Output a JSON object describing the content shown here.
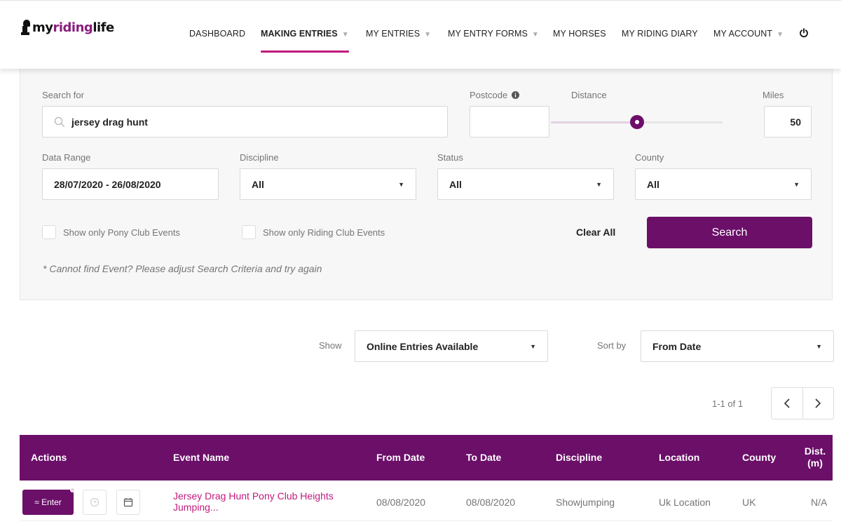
{
  "app": {
    "logo_prefix": "my",
    "logo_accent": "riding",
    "logo_suffix": "life"
  },
  "nav": {
    "dashboard": "DASHBOARD",
    "making_entries": "MAKING ENTRIES",
    "my_entries": "MY ENTRIES",
    "my_entry_forms": "MY ENTRY FORMS",
    "my_horses": "MY HORSES",
    "my_riding_diary": "MY RIDING DIARY",
    "my_account": "MY ACCOUNT",
    "active": "MAKING ENTRIES"
  },
  "search": {
    "search_for_label": "Search for",
    "search_value": "jersey drag hunt",
    "postcode_label": "Postcode",
    "postcode_value": "",
    "distance_label": "Distance",
    "distance_fraction": 0.5,
    "miles_label": "Miles",
    "miles_value": "50",
    "date_range_label": "Data Range",
    "date_range_value": "28/07/2020 - 26/08/2020",
    "discipline_label": "Discipline",
    "discipline_value": "All",
    "status_label": "Status",
    "status_value": "All",
    "county_label": "County",
    "county_value": "All",
    "pony_club_label": "Show only Pony Club Events",
    "riding_club_label": "Show only Riding Club Events",
    "clear_all_label": "Clear All",
    "search_button_label": "Search",
    "hint": "* Cannot find Event? Please adjust Search Criteria and try again"
  },
  "results": {
    "show_label": "Show",
    "show_value": "Online Entries Available",
    "sort_label": "Sort by",
    "sort_value": "From Date",
    "pager_info": "1-1 of 1"
  },
  "table": {
    "headers": {
      "actions": "Actions",
      "event_name": "Event Name",
      "from_date": "From Date",
      "to_date": "To Date",
      "discipline": "Discipline",
      "location": "Location",
      "county": "County",
      "dist_line1": "Dist.",
      "dist_line2": "(m)"
    },
    "rows": [
      {
        "enter_label": "≈ Enter",
        "event_name": "Jersey Drag Hunt Pony Club Heights Jumping...",
        "from_date": "08/08/2020",
        "to_date": "08/08/2020",
        "discipline": "Showjumping",
        "location": "Uk Location",
        "county": "UK",
        "dist": "N/A"
      }
    ]
  },
  "colors": {
    "brand": "#6b0f69",
    "accent": "#c2197f"
  },
  "icons": [
    "search-icon",
    "info-icon",
    "chevron-down-icon",
    "power-icon",
    "chevron-left-icon",
    "chevron-right-icon",
    "clock-icon",
    "calendar-add-icon"
  ]
}
